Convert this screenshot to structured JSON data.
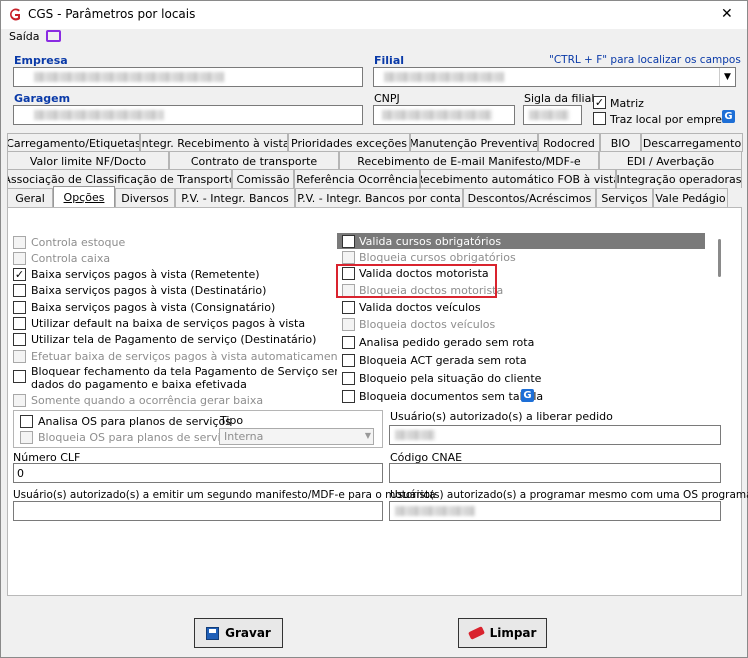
{
  "window": {
    "title": "CGS - Parâmetros por locais",
    "close_glyph": "✕"
  },
  "menu": {
    "saida": "Saída"
  },
  "header": {
    "empresa_label": "Empresa",
    "filial_label": "Filial",
    "ctrl_f_hint": "\"CTRL + F\" para localizar os campos",
    "garagem_label": "Garagem",
    "cnpj_label": "CNPJ",
    "sigla_label": "Sigla da filial",
    "matriz_label": "Matriz",
    "traz_local_label": "Traz local por empresa"
  },
  "tabs": {
    "row1": [
      "Carregamento/Etiquetas",
      "Integr. Recebimento à vista",
      "Prioridades exceções",
      "Manutenção Preventiva",
      "Rodocred",
      "BIO",
      "Descarregamento"
    ],
    "row2": [
      "Valor limite NF/Docto",
      "Contrato de transporte",
      "Recebimento de E-mail Manifesto/MDF-e",
      "EDI / Averbação"
    ],
    "row3": [
      "Associação de Classificação de Transporte",
      "Comissão",
      "Referência Ocorrência",
      "Recebimento automático FOB à vista",
      "Integração operadoras"
    ],
    "row4": [
      "Geral",
      "Opções",
      "Diversos",
      "P.V. - Integr. Bancos",
      "P.V. - Integr. Bancos por conta",
      "Descontos/Acréscimos",
      "Serviços",
      "Vale Pedágio"
    ]
  },
  "left_options": [
    {
      "label": "Controla estoque",
      "checked": false,
      "disabled": true
    },
    {
      "label": "Controla caixa",
      "checked": false,
      "disabled": true
    },
    {
      "label": "Baixa serviços pagos à vista (Remetente)",
      "checked": true,
      "disabled": false
    },
    {
      "label": "Baixa serviços pagos à vista (Destinatário)",
      "checked": false,
      "disabled": false
    },
    {
      "label": "Baixa serviços pagos à vista (Consignatário)",
      "checked": false,
      "disabled": false
    },
    {
      "label": "Utilizar default na baixa de serviços pagos à vista",
      "checked": false,
      "disabled": false
    },
    {
      "label": "Utilizar tela de Pagamento de serviço (Destinatário)",
      "checked": false,
      "disabled": false
    },
    {
      "label": "Efetuar baixa de serviços pagos à vista automaticamente",
      "checked": false,
      "disabled": true
    },
    {
      "label": "Bloquear fechamento da tela Pagamento de Serviço sem",
      "label2": "dados do pagamento e baixa efetivada",
      "checked": false,
      "disabled": false
    },
    {
      "label": "Somente quando a ocorrência gerar baixa",
      "checked": false,
      "disabled": true
    }
  ],
  "right_options": [
    {
      "label": "Valida cursos obrigatórios",
      "checked": false,
      "disabled": false
    },
    {
      "label": "Bloqueia cursos obrigatórios",
      "checked": false,
      "disabled": true
    },
    {
      "label": "Valida doctos motorista",
      "checked": false,
      "disabled": false
    },
    {
      "label": "Bloqueia doctos motorista",
      "checked": false,
      "disabled": true
    },
    {
      "label": "Valida doctos veículos",
      "checked": false,
      "disabled": false
    },
    {
      "label": "Bloqueia doctos veículos",
      "checked": false,
      "disabled": true
    },
    {
      "label": "Analisa pedido gerado sem rota",
      "checked": false,
      "disabled": false
    },
    {
      "label": "Bloqueia ACT gerada sem rota",
      "checked": false,
      "disabled": false
    },
    {
      "label": "Bloqueio pela situação do cliente",
      "checked": false,
      "disabled": false
    },
    {
      "label": "Bloqueia documentos sem tabela",
      "checked": false,
      "disabled": false
    }
  ],
  "os_group": {
    "analisa_label": "Analisa OS para planos de serviços",
    "bloqueia_label": "Bloqueia OS para planos de serviços",
    "tipo_label": "Tipo",
    "tipo_value": "Interna"
  },
  "fields": {
    "usuario_liberar_label": "Usuário(s) autorizado(s) a liberar pedido",
    "numero_clf_label": "Número CLF",
    "numero_clf_value": "0",
    "codigo_cnae_label": "Código CNAE",
    "usuario_manifesto_label": "Usuário(s) autorizado(s) a emitir um segundo manifesto/MDF-e para o motorista",
    "usuario_programar_label": "Usuário(s) autorizado(s) a programar mesmo com uma OS programada"
  },
  "buttons": {
    "gravar": "Gravar",
    "limpar": "Limpar"
  },
  "colors": {
    "highlight_box": "#d9232e",
    "logo_red": "#c8222b",
    "tv_icon": "#8a2be2",
    "link_blue": "#0a3aa8"
  }
}
